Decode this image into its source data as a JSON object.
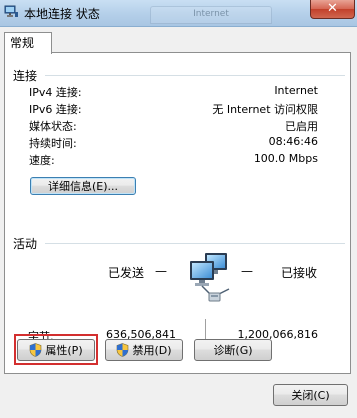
{
  "window": {
    "title": "本地连接 状态",
    "background_tab": "Internet",
    "close_glyph": "✕"
  },
  "tab": {
    "label": "常规"
  },
  "connection": {
    "section_title": "连接",
    "rows": [
      {
        "label": "IPv4 连接:",
        "value": "Internet"
      },
      {
        "label": "IPv6 连接:",
        "value": "无 Internet 访问权限"
      },
      {
        "label": "媒体状态:",
        "value": "已启用"
      },
      {
        "label": "持续时间:",
        "value": "08:46:46"
      },
      {
        "label": "速度:",
        "value": "100.0 Mbps"
      }
    ],
    "details_button": "详细信息(E)..."
  },
  "activity": {
    "section_title": "活动",
    "sent_label": "已发送",
    "received_label": "已接收",
    "dash": "—",
    "bytes_label": "字节:",
    "bytes_sent": "636,506,841",
    "bytes_received": "1,200,066,816"
  },
  "buttons": {
    "properties": "属性(P)",
    "disable": "禁用(D)",
    "diagnose": "诊断(G)",
    "close": "关闭(C)"
  },
  "icons": {
    "app": "network-icon",
    "network_activity": "network-computers-icon",
    "shield": "uac-shield-icon"
  },
  "colors": {
    "highlight_box": "#d32f2f"
  }
}
